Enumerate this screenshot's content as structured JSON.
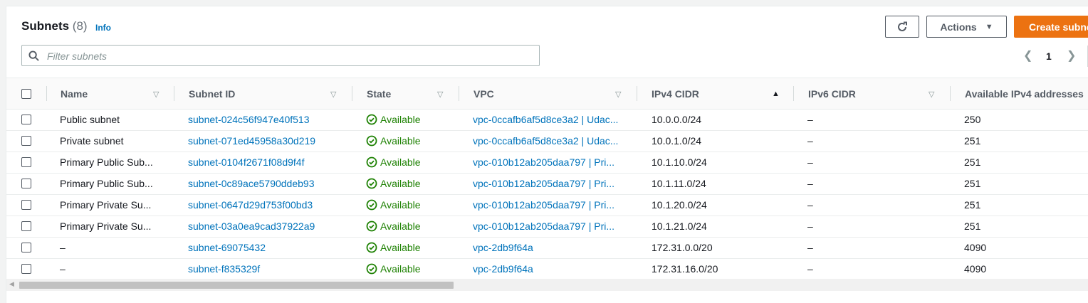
{
  "header": {
    "title": "Subnets",
    "count": "(8)",
    "info": "Info"
  },
  "toolbar": {
    "actions_label": "Actions",
    "create_label": "Create subnet"
  },
  "search": {
    "placeholder": "Filter subnets"
  },
  "pagination": {
    "current_page": "1"
  },
  "columns": [
    "Name",
    "Subnet ID",
    "State",
    "VPC",
    "IPv4 CIDR",
    "IPv6 CIDR",
    "Available IPv4 addresses"
  ],
  "sort": {
    "column": "IPv4 CIDR",
    "direction": "ascending"
  },
  "rows": [
    {
      "name": "Public subnet",
      "subnet_id": "subnet-024c56f947e40f513",
      "state": "Available",
      "vpc": "vpc-0ccafb6af5d8ce3a2 | Udac...",
      "ipv4_cidr": "10.0.0.0/24",
      "ipv6_cidr": "–",
      "available_ipv4": "250"
    },
    {
      "name": "Private subnet",
      "subnet_id": "subnet-071ed45958a30d219",
      "state": "Available",
      "vpc": "vpc-0ccafb6af5d8ce3a2 | Udac...",
      "ipv4_cidr": "10.0.1.0/24",
      "ipv6_cidr": "–",
      "available_ipv4": "251"
    },
    {
      "name": "Primary Public Sub...",
      "subnet_id": "subnet-0104f2671f08d9f4f",
      "state": "Available",
      "vpc": "vpc-010b12ab205daa797 | Pri...",
      "ipv4_cidr": "10.1.10.0/24",
      "ipv6_cidr": "–",
      "available_ipv4": "251"
    },
    {
      "name": "Primary Public Sub...",
      "subnet_id": "subnet-0c89ace5790ddeb93",
      "state": "Available",
      "vpc": "vpc-010b12ab205daa797 | Pri...",
      "ipv4_cidr": "10.1.11.0/24",
      "ipv6_cidr": "–",
      "available_ipv4": "251"
    },
    {
      "name": "Primary Private Su...",
      "subnet_id": "subnet-0647d29d753f00bd3",
      "state": "Available",
      "vpc": "vpc-010b12ab205daa797 | Pri...",
      "ipv4_cidr": "10.1.20.0/24",
      "ipv6_cidr": "–",
      "available_ipv4": "251"
    },
    {
      "name": "Primary Private Su...",
      "subnet_id": "subnet-03a0ea9cad37922a9",
      "state": "Available",
      "vpc": "vpc-010b12ab205daa797 | Pri...",
      "ipv4_cidr": "10.1.21.0/24",
      "ipv6_cidr": "–",
      "available_ipv4": "251"
    },
    {
      "name": "–",
      "subnet_id": "subnet-69075432",
      "state": "Available",
      "vpc": "vpc-2db9f64a",
      "ipv4_cidr": "172.31.0.0/20",
      "ipv6_cidr": "–",
      "available_ipv4": "4090"
    },
    {
      "name": "–",
      "subnet_id": "subnet-f835329f",
      "state": "Available",
      "vpc": "vpc-2db9f64a",
      "ipv4_cidr": "172.31.16.0/20",
      "ipv6_cidr": "–",
      "available_ipv4": "4090"
    }
  ],
  "icons": {
    "refresh": "refresh-icon",
    "search": "search-icon",
    "status": "check-circle-icon",
    "filter": "filter-triangle-icon"
  },
  "colors": {
    "primary": "#ec7211",
    "link": "#0073bb",
    "success": "#1d8102"
  }
}
